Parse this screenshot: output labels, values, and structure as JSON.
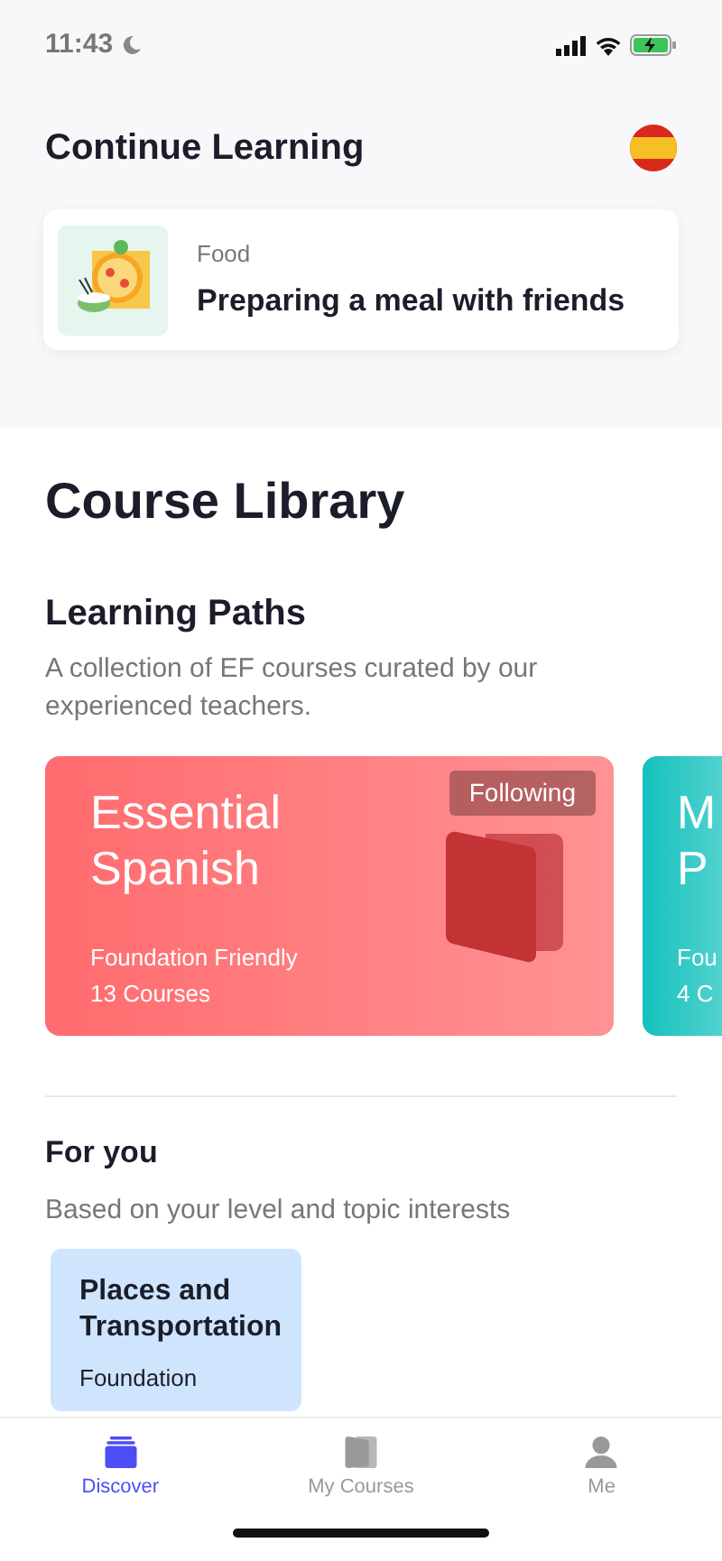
{
  "status_bar": {
    "time": "11:43"
  },
  "continue_learning": {
    "title": "Continue Learning",
    "item": {
      "category": "Food",
      "title": "Preparing a meal with friends"
    }
  },
  "course_library": {
    "title": "Course Library"
  },
  "learning_paths": {
    "title": "Learning Paths",
    "description": "A collection of EF courses curated by our experienced teachers.",
    "paths": [
      {
        "title_lines": [
          "Essential",
          "Spanish"
        ],
        "level": "Foundation Friendly",
        "count": "13 Courses",
        "badge": "Following",
        "color": "#ff6b6e"
      },
      {
        "title_lines": [
          "M",
          "P"
        ],
        "level": "Fou",
        "count": "4 C",
        "color": "#13c1bd"
      }
    ]
  },
  "for_you": {
    "title": "For you",
    "description": "Based on your level and topic interests",
    "courses": [
      {
        "title": "Places and Transportation",
        "level": "Foundation"
      }
    ]
  },
  "tabs": [
    {
      "kind": "discover",
      "label": "Discover",
      "selected": true
    },
    {
      "kind": "courses",
      "label": "My Courses",
      "selected": false
    },
    {
      "kind": "me",
      "label": "Me",
      "selected": false
    }
  ]
}
